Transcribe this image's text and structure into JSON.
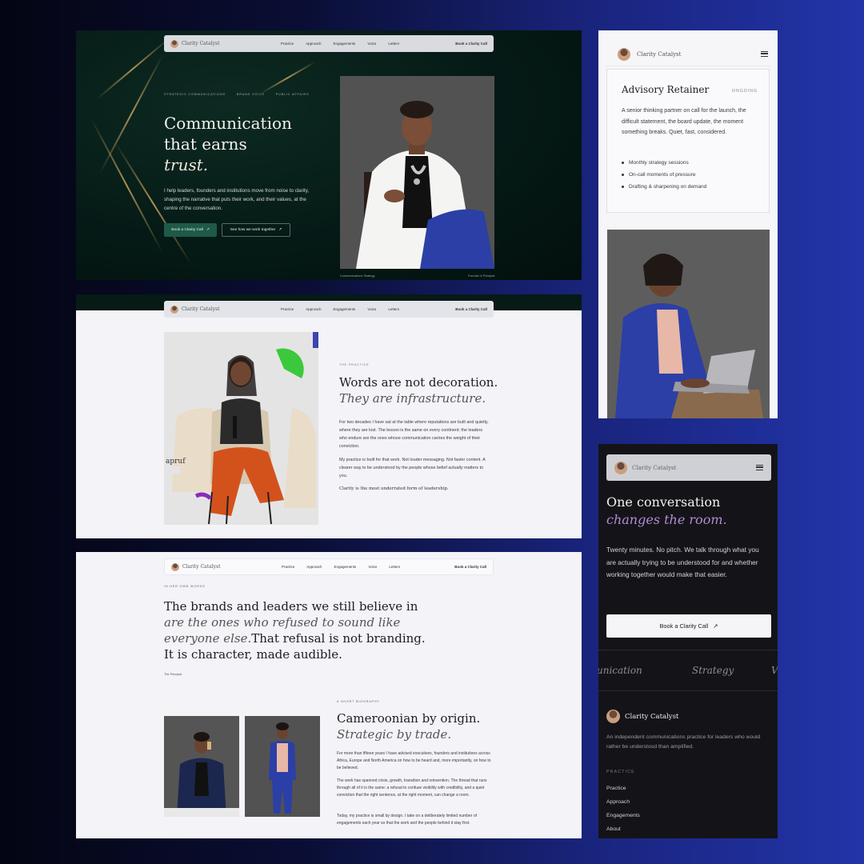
{
  "nav": {
    "brand": "Clarity Catalyst",
    "links": [
      "Practice",
      "Approach",
      "Engagements",
      "Voice",
      "Letters"
    ],
    "cta": "Book a Clarity Call"
  },
  "hero": {
    "eyebrow": [
      "STRATEGIC COMMUNICATIONS",
      "BRAND VOICE",
      "PUBLIC AFFAIRS"
    ],
    "title_line1": "Communication",
    "title_line2": "that earns",
    "title_em": "trust.",
    "lead": "I help leaders, founders and institutions move from noise to clarity, shaping the narrative that puts their work, and their values, at the centre of the conversation.",
    "primary_btn": "Book a Clarity Call",
    "secondary_btn": "See how we work together",
    "caption_left": "Communications Strategy",
    "caption_right": "Founder & Principal"
  },
  "practice": {
    "eyebrow": "THE PRACTICE",
    "title": "Words are not decoration.",
    "title_em": "They are infrastructure.",
    "p1": "For two decades I have sat at the table where reputations are built and quietly, where they are lost. The lesson is the same on every continent: the leaders who endure are the ones whose communication carries the weight of their conviction.",
    "p2": "My practice is built for that work. Not louder messaging. Not faster content. A clearer way to be understood by the people whose belief actually matters to you.",
    "note": "Clarity is the most underrated form of leadership.",
    "photo_text": "apruf"
  },
  "words": {
    "eyebrow": "IN HER OWN WORDS",
    "quote_start": "The brands and leaders we still believe in ",
    "quote_em": "are the ones who refused to sound like everyone else.",
    "quote_end": "That refusal is not branding. It is character, made audible.",
    "attribution": "The Principal",
    "bio_eyebrow": "A SHORT BIOGRAPHY",
    "bio_title": "Cameroonian by origin.",
    "bio_title_em": "Strategic by trade.",
    "bio_p1": "For more than fifteen years I have advised executives, founders and institutions across Africa, Europe and North America on how to be heard and, more importantly, on how to be believed.",
    "bio_p2": "The work has spanned crisis, growth, transition and reinvention. The thread that runs through all of it is the same: a refusal to confuse visibility with credibility, and a quiet conviction that the right sentence, at the right moment, can change a room.",
    "bio_p3": "Today, my practice is small by design. I take on a deliberately limited number of engagements each year so that the work and the people behind it stay first."
  },
  "retainer": {
    "title": "Advisory Retainer",
    "tag": "ONGOING",
    "desc": "A senior thinking partner on call for the launch, the difficult statement, the board update, the moment something breaks. Quiet, fast, considered.",
    "items": [
      "Monthly strategy sessions",
      "On-call moments of pressure",
      "Drafting & sharpening on demand"
    ]
  },
  "dark": {
    "title": "One conversation",
    "title_em": "changes the room.",
    "lead": "Twenty minutes. No pitch. We talk through what you are actually trying to be understood for and whether working together would make that easier.",
    "cta": "Book a Clarity Call",
    "marquee": [
      "unication",
      "Strategy",
      "V"
    ],
    "brand": "Clarity Catalyst",
    "tagline": "An independent communications practice for leaders who would rather be understood than amplified.",
    "footer_heading": "PRACTICE",
    "footer_links": [
      "Practice",
      "Approach",
      "Engagements",
      "About"
    ]
  },
  "colors": {
    "hero_bg": "#051a16",
    "accent_green": "#1e5a48",
    "accent_purple": "#b48bd6",
    "gold": "#cda55f"
  }
}
